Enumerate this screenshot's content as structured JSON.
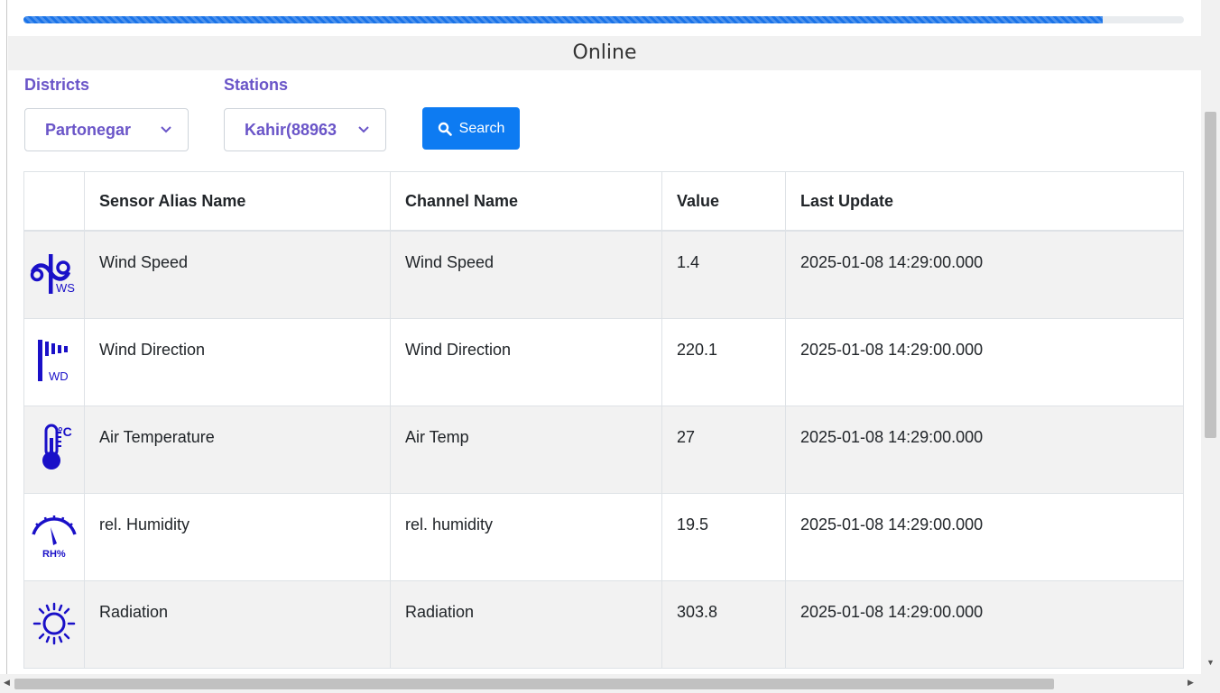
{
  "progress": {
    "percent": 93
  },
  "status": {
    "label": "Online"
  },
  "filters": {
    "districts_label": "Districts",
    "district_value": "Partonegar",
    "stations_label": "Stations",
    "station_value": "Kahir(88963",
    "search_label": "Search"
  },
  "table": {
    "headers": [
      "",
      "Sensor Alias Name",
      "Channel Name",
      "Value",
      "Last Update"
    ],
    "rows": [
      {
        "icon": "wind-speed-icon",
        "alias": "Wind Speed",
        "channel": "Wind Speed",
        "value": "1.4",
        "updated": "2025-01-08 14:29:00.000"
      },
      {
        "icon": "wind-direction-icon",
        "alias": "Wind Direction",
        "channel": "Wind Direction",
        "value": "220.1",
        "updated": "2025-01-08 14:29:00.000"
      },
      {
        "icon": "thermometer-icon",
        "alias": "Air Temperature",
        "channel": "Air Temp",
        "value": "27",
        "updated": "2025-01-08 14:29:00.000"
      },
      {
        "icon": "humidity-gauge-icon",
        "alias": "rel. Humidity",
        "channel": "rel. humidity",
        "value": "19.5",
        "updated": "2025-01-08 14:29:00.000"
      },
      {
        "icon": "sun-radiation-icon",
        "alias": "Radiation",
        "channel": "Radiation",
        "value": "303.8",
        "updated": "2025-01-08 14:29:00.000"
      }
    ]
  },
  "icon_labels": {
    "ws": "WS",
    "wd": "WD",
    "temp_unit": "°C",
    "rh": "RH%"
  },
  "colors": {
    "accent": "#6a55c8",
    "button": "#0d7bf2",
    "icon": "#1a10c8",
    "progress": "#1a73e8"
  }
}
